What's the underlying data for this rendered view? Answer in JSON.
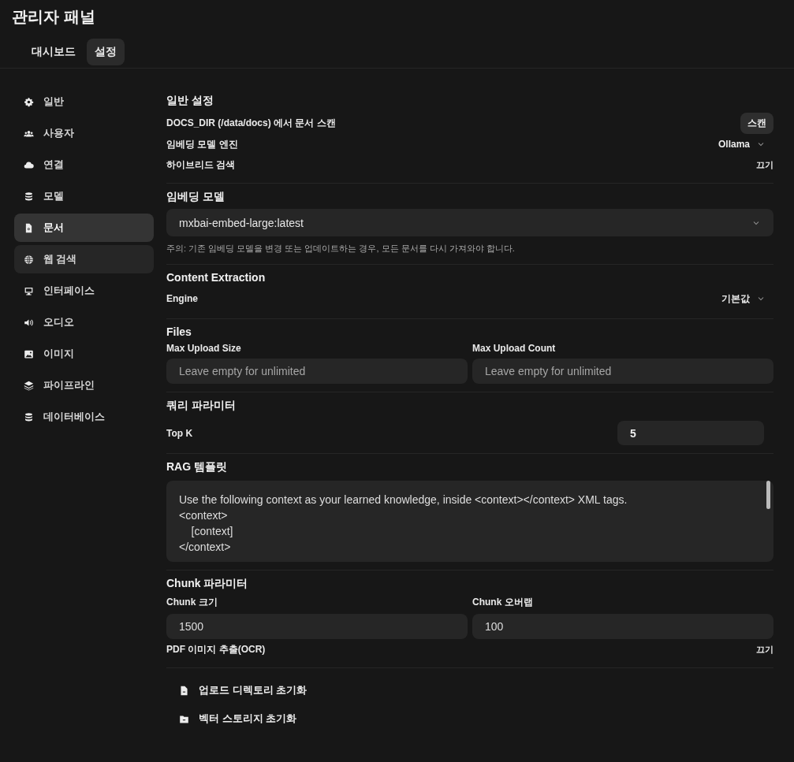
{
  "title": "관리자 패널",
  "tabs": [
    {
      "label": "대시보드",
      "selected": false
    },
    {
      "label": "설정",
      "selected": true
    }
  ],
  "sidebar": {
    "items": [
      {
        "label": "일반",
        "selected": false,
        "hovered": false
      },
      {
        "label": "사용자",
        "selected": false,
        "hovered": false
      },
      {
        "label": "연결",
        "selected": false,
        "hovered": false
      },
      {
        "label": "모델",
        "selected": false,
        "hovered": false
      },
      {
        "label": "문서",
        "selected": true,
        "hovered": false
      },
      {
        "label": "웹 검색",
        "selected": false,
        "hovered": true
      },
      {
        "label": "인터페이스",
        "selected": false,
        "hovered": false
      },
      {
        "label": "오디오",
        "selected": false,
        "hovered": false
      },
      {
        "label": "이미지",
        "selected": false,
        "hovered": false
      },
      {
        "label": "파이프라인",
        "selected": false,
        "hovered": false
      },
      {
        "label": "데이터베이스",
        "selected": false,
        "hovered": false
      }
    ]
  },
  "sections": [
    {
      "title": "일반 설정",
      "rows": [
        {
          "kind": "button",
          "label": "DOCS_DIR (/data/docs) 에서 문서 스캔",
          "value": "스캔"
        },
        {
          "kind": "select",
          "label": "임베딩 모델 엔진",
          "value": "Ollama"
        },
        {
          "kind": "toggle",
          "label": "하이브리드 검색",
          "value": "끄기"
        }
      ]
    },
    {
      "title": "임베딩 모델",
      "rows": [
        {
          "kind": "wide-select",
          "value": "mxbai-embed-large:latest"
        },
        {
          "kind": "note",
          "label": "주의: 기존 임베딩 모델을 변경 또는 업데이트하는 경우, 모든 문서를 다시 가져와야 합니다."
        }
      ]
    },
    {
      "title": "Content Extraction",
      "rows": [
        {
          "kind": "select",
          "label": "Engine",
          "value": "기본값"
        }
      ]
    },
    {
      "title": "Files",
      "rows": [
        {
          "kind": "field-pair",
          "fields": [
            {
              "label": "Max Upload Size",
              "placeholder": "Leave empty for unlimited"
            },
            {
              "label": "Max Upload Count",
              "placeholder": "Leave empty for unlimited"
            }
          ]
        }
      ]
    },
    {
      "title": "쿼리 파라미터",
      "rows": [
        {
          "kind": "number",
          "label": "Top K",
          "value": "5"
        }
      ]
    },
    {
      "title": "RAG 템플릿",
      "rows": [
        {
          "kind": "textarea",
          "value": "Use the following context as your learned knowledge, inside <context></context> XML tags.\n<context>\n    [context]\n</context>"
        }
      ]
    },
    {
      "title": "Chunk 파라미터",
      "rows": [
        {
          "kind": "field-pair",
          "fields": [
            {
              "label": "Chunk 크기",
              "value": "1500"
            },
            {
              "label": "Chunk 오버랩",
              "value": "100"
            }
          ]
        },
        {
          "kind": "toggle",
          "label": "PDF 이미지 추출(OCR)",
          "value": "끄기"
        }
      ]
    }
  ],
  "actions": [
    {
      "label": "업로드 디렉토리 초기화"
    },
    {
      "label": "벡터 스토리지 초기화"
    }
  ]
}
